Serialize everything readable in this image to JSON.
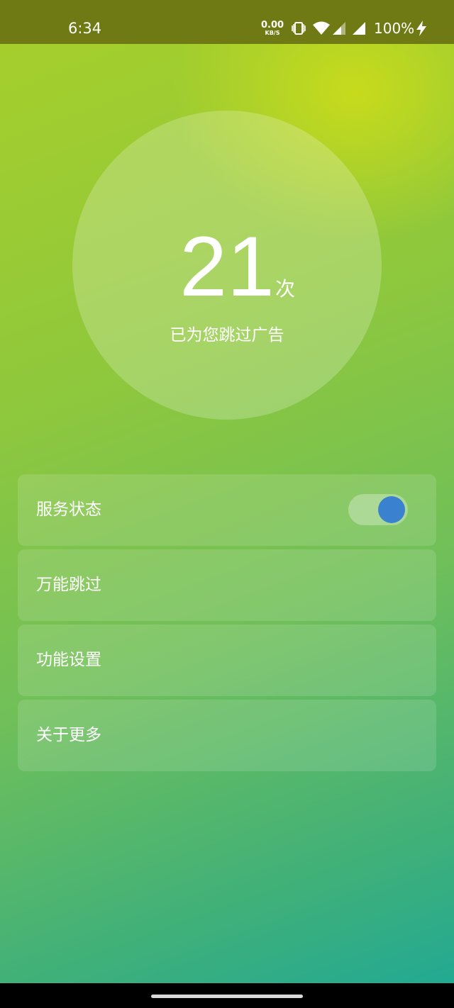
{
  "status_bar": {
    "time": "6:34",
    "net_speed_value": "0.00",
    "net_speed_unit": "KB/S",
    "battery": "100%",
    "icons": [
      "vibrate-icon",
      "wifi-icon",
      "signal-icon",
      "signal-icon",
      "charging-icon"
    ]
  },
  "counter": {
    "value": "21",
    "unit": "次",
    "caption": "已为您跳过广告"
  },
  "menu": {
    "items": [
      {
        "label": "服务状态",
        "has_toggle": true,
        "toggle_on": true
      },
      {
        "label": "万能跳过"
      },
      {
        "label": "功能设置"
      },
      {
        "label": "关于更多"
      }
    ]
  },
  "colors": {
    "status_bar": "#6f7a14",
    "toggle_knob": "#3a82cf",
    "gradient_top": "#a8cf2a",
    "gradient_bottom": "#1ea896"
  }
}
